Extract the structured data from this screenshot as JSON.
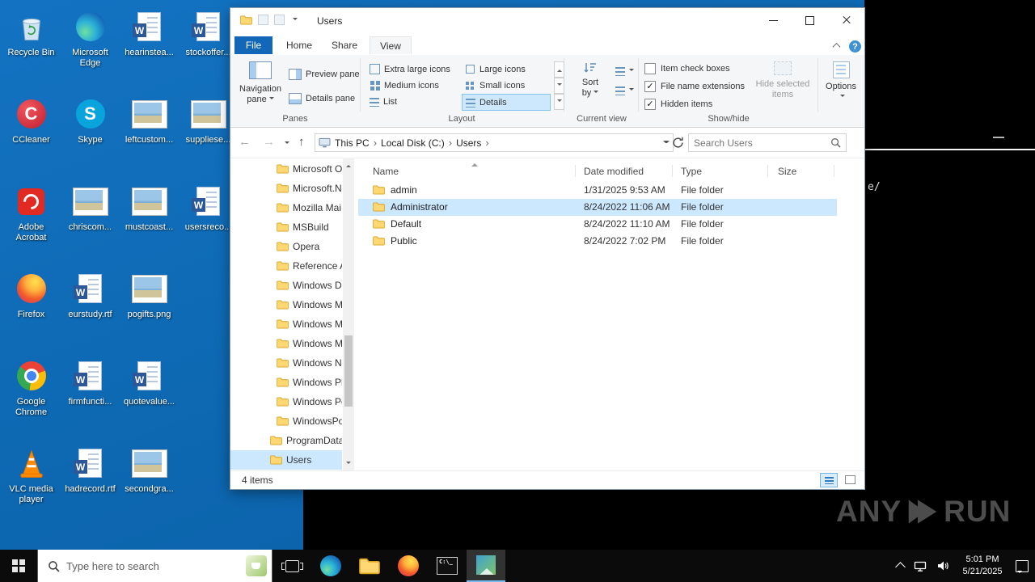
{
  "colors": {
    "selection": "#cce8ff",
    "file_tab": "#1267b8",
    "desktop": "#0e67b0",
    "taskbar": "#0b0b0b"
  },
  "desktop": {
    "icons": [
      {
        "label": "Recycle Bin"
      },
      {
        "label": "CCleaner"
      },
      {
        "label": "Adobe Acrobat"
      },
      {
        "label": "Firefox"
      },
      {
        "label": "Google Chrome"
      },
      {
        "label": "VLC media player"
      },
      {
        "label": "Microsoft Edge"
      },
      {
        "label": "Skype"
      },
      {
        "label": "chriscom..."
      },
      {
        "label": "eurstudy.rtf"
      },
      {
        "label": "firmfuncti..."
      },
      {
        "label": "hadrecord.rtf"
      },
      {
        "label": "hearinstea..."
      },
      {
        "label": "leftcustom..."
      },
      {
        "label": "mustcoast..."
      },
      {
        "label": "pogifts.png"
      },
      {
        "label": "quotevalue..."
      },
      {
        "label": "secondgra..."
      },
      {
        "label": "stockoffer..."
      },
      {
        "label": "suppliese..."
      },
      {
        "label": "usersreco..."
      }
    ]
  },
  "console": {
    "fragment": "e/"
  },
  "watermark": {
    "left": "ANY",
    "right": "RUN"
  },
  "explorer": {
    "title": "Users",
    "help": "?",
    "tabs": {
      "file": "File",
      "home": "Home",
      "share": "Share",
      "view": "View"
    },
    "ribbon": {
      "panes": {
        "group": "Panes",
        "navigation_line1": "Navigation",
        "navigation_line2": "pane",
        "preview": "Preview pane",
        "details": "Details pane"
      },
      "layout": {
        "group": "Layout",
        "options": [
          "Extra large icons",
          "Large icons",
          "Medium icons",
          "Small icons",
          "List",
          "Details"
        ]
      },
      "current_view": {
        "group": "Current view",
        "sort_line1": "Sort",
        "sort_line2": "by"
      },
      "showhide": {
        "group": "Show/hide",
        "item_check_boxes": "Item check boxes",
        "file_name_extensions": "File name extensions",
        "hidden_items": "Hidden items",
        "hide_selected_line1": "Hide selected",
        "hide_selected_line2": "items"
      },
      "options_label": "Options"
    },
    "address": {
      "crumbs": [
        "This PC",
        "Local Disk (C:)",
        "Users"
      ],
      "search_placeholder": "Search Users"
    },
    "tree": [
      "Microsoft O",
      "Microsoft.N",
      "Mozilla Mai",
      "MSBuild",
      "Opera",
      "Reference A",
      "Windows D",
      "Windows M",
      "Windows M",
      "Windows M",
      "Windows N",
      "Windows Ph",
      "Windows Po",
      "WindowsPo",
      "ProgramData",
      "Users"
    ],
    "list": {
      "columns": [
        "Name",
        "Date modified",
        "Type",
        "Size"
      ],
      "rows": [
        {
          "name": "admin",
          "date": "1/31/2025 9:53 AM",
          "type": "File folder",
          "size": ""
        },
        {
          "name": "Administrator",
          "date": "8/24/2022 11:06 AM",
          "type": "File folder",
          "size": ""
        },
        {
          "name": "Default",
          "date": "8/24/2022 11:10 AM",
          "type": "File folder",
          "size": ""
        },
        {
          "name": "Public",
          "date": "8/24/2022 7:02 PM",
          "type": "File folder",
          "size": ""
        }
      ]
    },
    "status": "4 items"
  },
  "taskbar": {
    "search_placeholder": "Type here to search",
    "time": "5:01 PM",
    "date": "5/21/2025"
  }
}
